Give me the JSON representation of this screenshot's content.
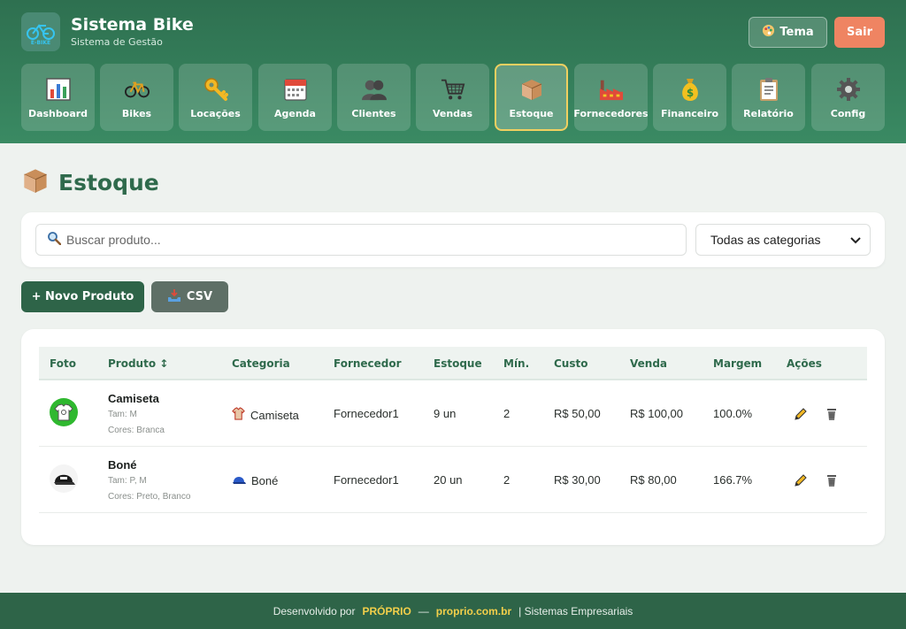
{
  "header": {
    "title": "Sistema Bike",
    "subtitle": "Sistema de Gestão",
    "logo_text": "E-BIKE",
    "tema_label": "Tema",
    "sair_label": "Sair"
  },
  "nav": [
    {
      "label": "Dashboard",
      "icon": "chart-icon"
    },
    {
      "label": "Bikes",
      "icon": "bicycle-icon"
    },
    {
      "label": "Locações",
      "icon": "key-icon"
    },
    {
      "label": "Agenda",
      "icon": "calendar-icon"
    },
    {
      "label": "Clientes",
      "icon": "users-icon"
    },
    {
      "label": "Vendas",
      "icon": "cart-icon"
    },
    {
      "label": "Estoque",
      "icon": "box-icon",
      "active": true
    },
    {
      "label": "Fornecedores",
      "icon": "factory-icon"
    },
    {
      "label": "Financeiro",
      "icon": "money-bag-icon"
    },
    {
      "label": "Relatório",
      "icon": "clipboard-icon"
    },
    {
      "label": "Config",
      "icon": "gear-icon"
    }
  ],
  "page": {
    "title": "Estoque"
  },
  "filters": {
    "search_placeholder": "Buscar produto...",
    "category_selected": "Todas as categorias"
  },
  "actions": {
    "novo_label": "+ Novo Produto",
    "csv_label": "CSV"
  },
  "table": {
    "headers": [
      "Foto",
      "Produto ↕",
      "Categoria",
      "Fornecedor",
      "Estoque",
      "Mín.",
      "Custo",
      "Venda",
      "Margem",
      "Ações"
    ],
    "rows": [
      {
        "name": "Camiseta",
        "tam": "Tam: M",
        "cores": "Cores: Branca",
        "categoria": "Camiseta",
        "fornecedor": "Fornecedor1",
        "estoque": "9 un",
        "min": "2",
        "custo": "R$ 50,00",
        "venda": "R$ 100,00",
        "margem": "100.0%"
      },
      {
        "name": "Boné",
        "tam": "Tam: P, M",
        "cores": "Cores: Preto, Branco",
        "categoria": "Boné",
        "fornecedor": "Fornecedor1",
        "estoque": "20 un",
        "min": "2",
        "custo": "R$ 30,00",
        "venda": "R$ 80,00",
        "margem": "166.7%"
      }
    ]
  },
  "footer": {
    "prefix": "Desenvolvido por",
    "brand": "PRÓPRIO",
    "dash": "—",
    "site": "proprio.com.br",
    "suffix": "| Sistemas Empresariais"
  },
  "colors": {
    "header_green": "#2e7050",
    "accent_green": "#2e6448",
    "sair_orange": "#ef8462",
    "active_border": "#f0d060",
    "footer_highlight": "#f3cf4a"
  }
}
